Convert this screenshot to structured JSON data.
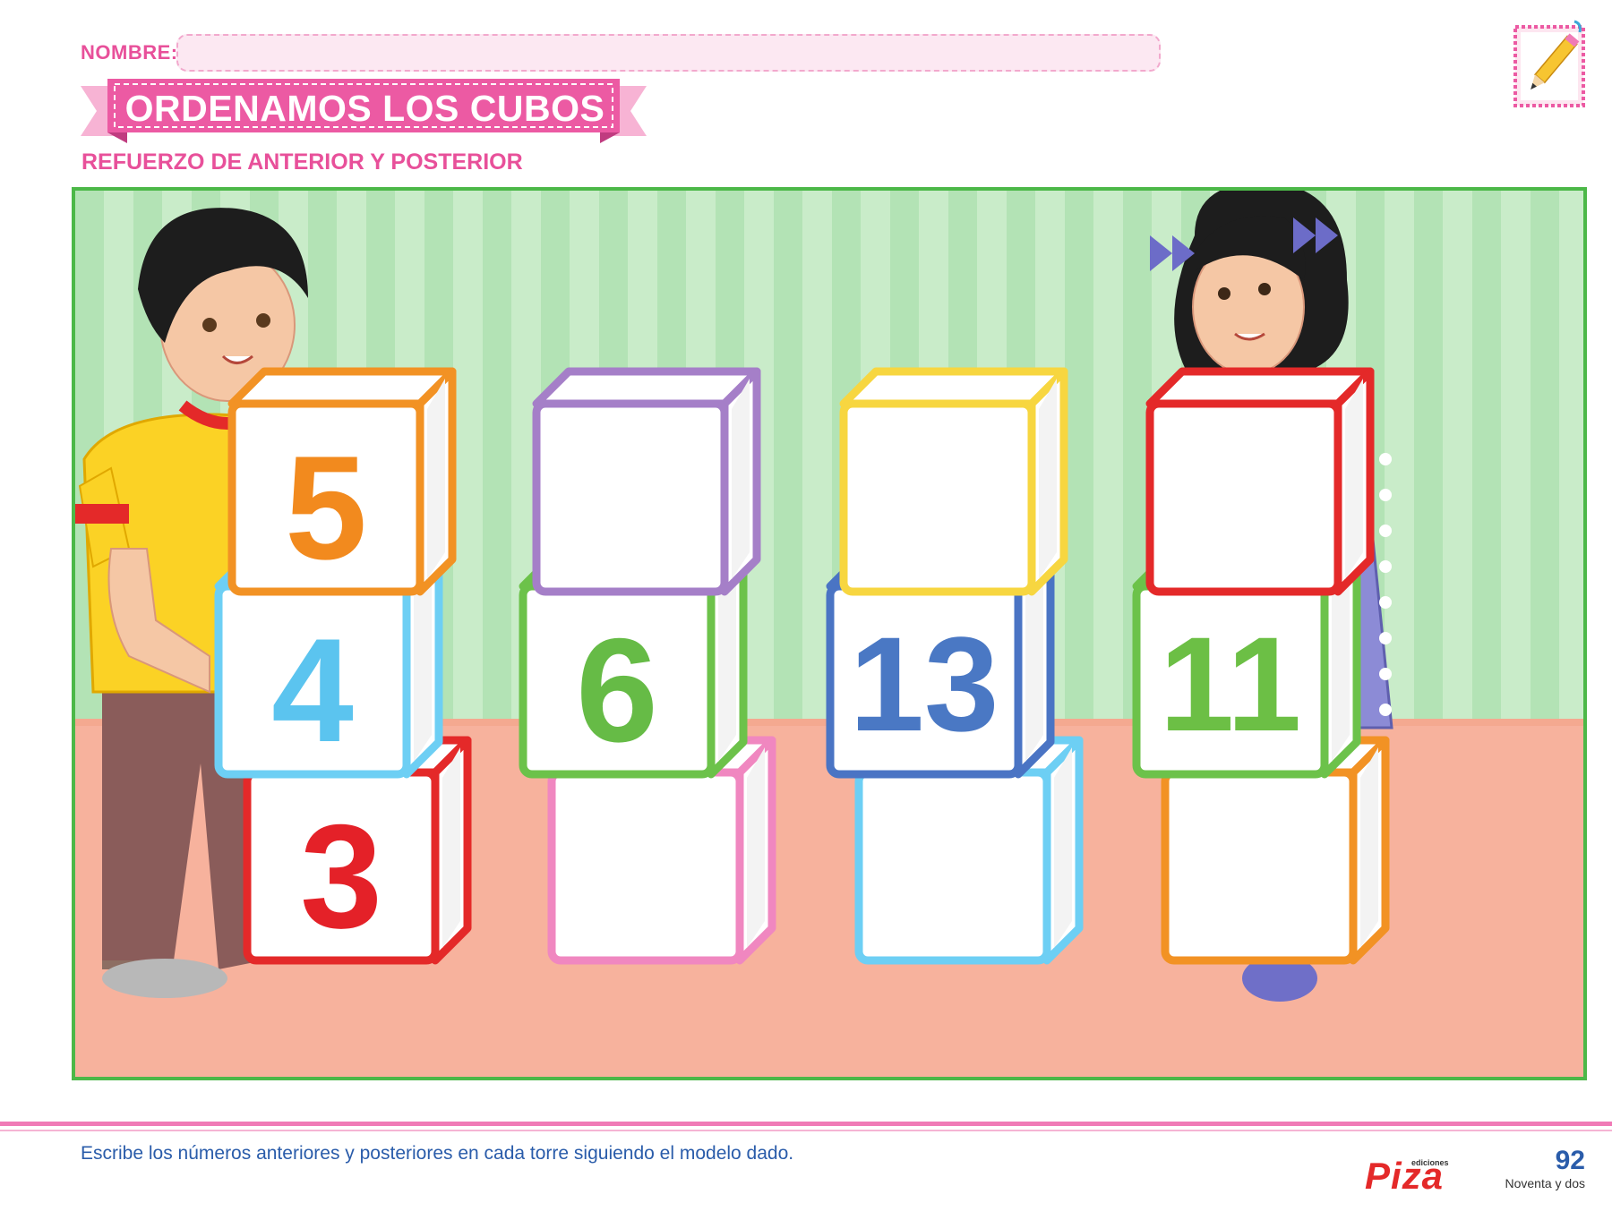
{
  "header": {
    "name_label": "NOMBRE:",
    "title": "ORDENAMOS LOS CUBOS",
    "subtitle": "REFUERZO DE ANTERIOR Y POSTERIOR"
  },
  "towers": [
    {
      "top": "5",
      "middle": "4",
      "bottom": "3",
      "colors": {
        "top": "#f29224",
        "middle": "#6dcff4",
        "bottom": "#e42929"
      },
      "number_colors": {
        "top": "#f28a1e",
        "middle": "#5bc4ef",
        "bottom": "#e42128"
      }
    },
    {
      "top": "",
      "middle": "6",
      "bottom": "",
      "colors": {
        "top": "#a57fc8",
        "middle": "#6cc24a",
        "bottom": "#f087c0"
      },
      "number_colors": {
        "top": "",
        "middle": "#66bb46",
        "bottom": ""
      }
    },
    {
      "top": "",
      "middle": "13",
      "bottom": "",
      "colors": {
        "top": "#f7d640",
        "middle": "#4a74c4",
        "bottom": "#6dcff4"
      },
      "number_colors": {
        "top": "",
        "middle": "#4a78c4",
        "bottom": ""
      }
    },
    {
      "top": "",
      "middle": "11",
      "bottom": "",
      "colors": {
        "top": "#e42929",
        "middle": "#6cc24a",
        "bottom": "#f29224"
      },
      "number_colors": {
        "top": "",
        "middle": "#6cbf45",
        "bottom": ""
      }
    }
  ],
  "footer": {
    "instruction": "Escribe los números anteriores y posteriores en cada torre siguiendo el modelo dado.",
    "brand_small": "ediciones",
    "brand": "Piza",
    "page_number": "92",
    "page_words": "Noventa y dos"
  },
  "colors": {
    "accent_pink": "#e8509a",
    "frame_green": "#4cb848",
    "footer_blue": "#2a5caa"
  },
  "icons": [
    "pencil-icon"
  ]
}
